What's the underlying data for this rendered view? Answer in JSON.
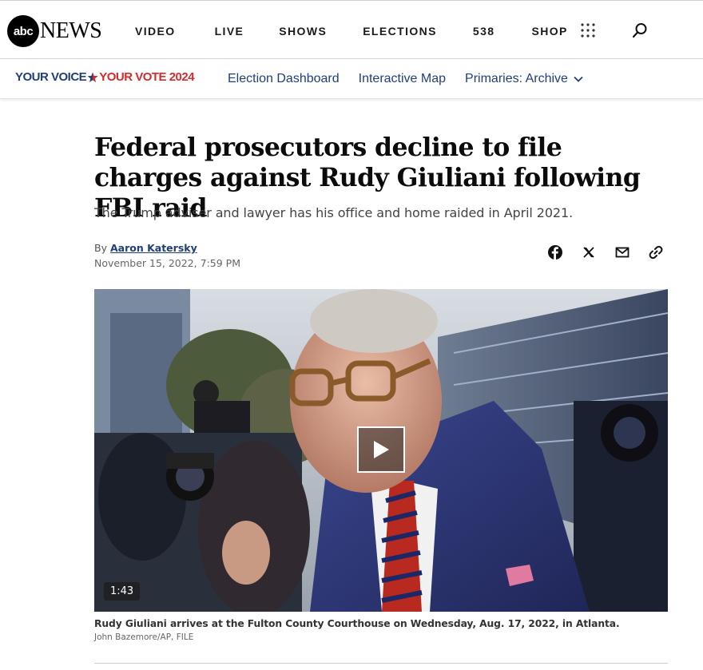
{
  "header": {
    "logo_abc": "abc",
    "logo_news": "NEWS",
    "nav": [
      "VIDEO",
      "LIVE",
      "SHOWS",
      "ELECTIONS",
      "538",
      "SHOP"
    ],
    "menu_icon": "grid-dots-icon",
    "search_icon": "search-icon"
  },
  "subnav": {
    "brand_part1": "YOUR VOICE",
    "brand_part2": "YOUR VOTE 2024",
    "links": [
      "Election Dashboard",
      "Interactive Map",
      "Primaries: Archive"
    ]
  },
  "article": {
    "headline": "Federal prosecutors decline to file charges against Rudy Giuliani following FBI raid",
    "subhead": "The Trump adviser and lawyer has his office and home raided in April 2021.",
    "by_prefix": "By",
    "author": "Aaron Katersky",
    "date": "November 15, 2022, 7:59 PM",
    "share_icons": [
      "facebook-icon",
      "x-icon",
      "mail-icon",
      "link-icon"
    ]
  },
  "media": {
    "duration": "1:43",
    "caption": "Rudy Giuliani arrives at the Fulton County Courthouse on Wednesday, Aug. 17, 2022, in Atlanta.",
    "credit": "John Bazemore/AP, FILE"
  },
  "colors": {
    "brand_blue": "#1f3f7a",
    "brand_red": "#d62b2b"
  }
}
